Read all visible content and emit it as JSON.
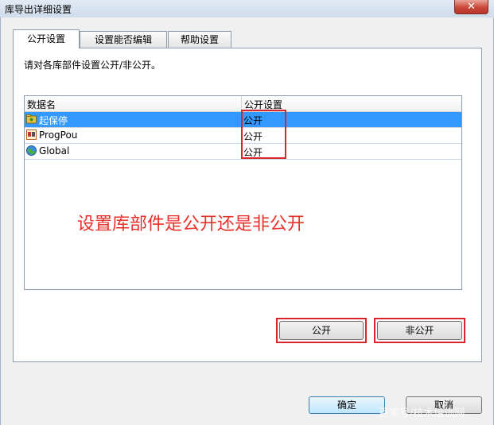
{
  "window": {
    "title": "库导出详细设置",
    "close_glyph": "✕"
  },
  "tabs": [
    {
      "label": "公开设置",
      "active": true
    },
    {
      "label": "设置能否编辑",
      "active": false
    },
    {
      "label": "帮助设置",
      "active": false
    }
  ],
  "panel": {
    "instruction": "请对各库部件设置公开/非公开。"
  },
  "list": {
    "headers": [
      "数据名",
      "公开设置"
    ],
    "rows": [
      {
        "name": "起保停",
        "icon": "folder-icon",
        "value": "公开",
        "selected": true
      },
      {
        "name": "ProgPou",
        "icon": "program-icon",
        "value": "公开",
        "selected": false
      },
      {
        "name": "Global",
        "icon": "globe-icon",
        "value": "公开",
        "selected": false
      }
    ]
  },
  "annotation": {
    "text": "设置库部件是公开还是非公开",
    "color": "#e8302a"
  },
  "buttons": {
    "public": "公开",
    "private": "非公开",
    "ok": "确定",
    "cancel": "取消"
  },
  "watermark": "百家号/技术培训网",
  "colors": {
    "selection": "#3399ff",
    "annotation_box": "#d9262b"
  }
}
